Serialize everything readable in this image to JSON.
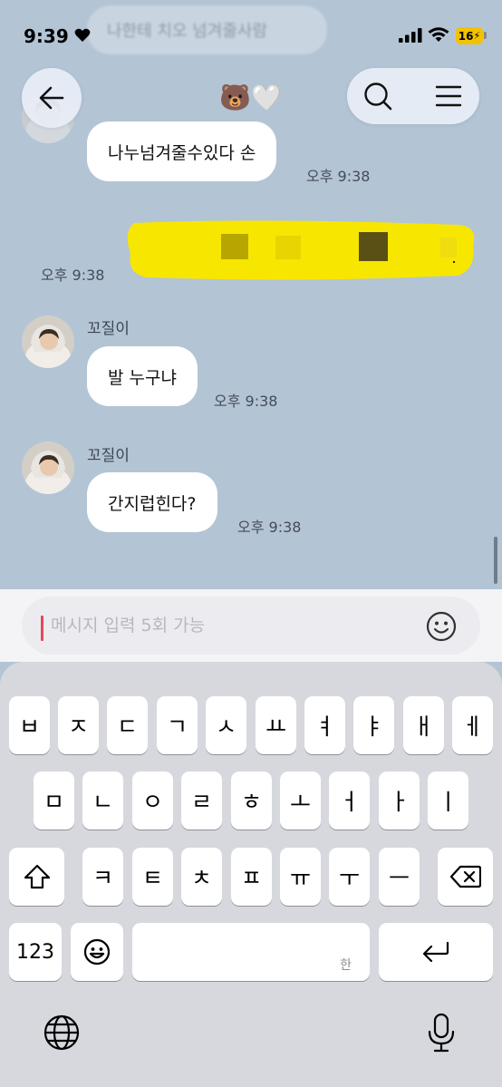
{
  "status_bar": {
    "time": "9:39",
    "battery": "16"
  },
  "header": {
    "back_icon": "arrow-left-icon",
    "title": "🐻🤍",
    "search_icon": "search-icon",
    "menu_icon": "hamburger-menu-icon"
  },
  "faded_message": {
    "text": "나한테 치오 넘겨줄사람"
  },
  "messages": [
    {
      "direction": "in",
      "sender": "",
      "text": "나누넘겨줄수있다 손",
      "time": "오후 9:38"
    },
    {
      "direction": "out",
      "sender": "",
      "text": "",
      "time": "오후 9:38",
      "redacted": true
    },
    {
      "direction": "in",
      "sender": "꼬질이",
      "text": "발 누구냐",
      "time": "오후 9:38"
    },
    {
      "direction": "in",
      "sender": "꼬질이",
      "text": "간지럽힌다?",
      "time": "오후 9:38"
    }
  ],
  "input": {
    "value": "",
    "placeholder": "메시지 입력 5회 가능",
    "emoji_icon": "smiley-icon"
  },
  "keyboard": {
    "row1": [
      "ㅂ",
      "ㅈ",
      "ㄷ",
      "ㄱ",
      "ㅅ",
      "ㅛ",
      "ㅕ",
      "ㅑ",
      "ㅐ",
      "ㅔ"
    ],
    "row2": [
      "ㅁ",
      "ㄴ",
      "ㅇ",
      "ㄹ",
      "ㅎ",
      "ㅗ",
      "ㅓ",
      "ㅏ",
      "ㅣ"
    ],
    "row3": [
      "ㅋ",
      "ㅌ",
      "ㅊ",
      "ㅍ",
      "ㅠ",
      "ㅜ",
      "ㅡ"
    ],
    "numbers_label": "123",
    "space_hint": "한",
    "shift_icon": "shift-icon",
    "delete_icon": "delete-icon",
    "return_icon": "return-icon",
    "emoji_icon": "emoji-icon",
    "globe_icon": "globe-icon",
    "mic_icon": "microphone-icon"
  },
  "colors": {
    "chat_background": "#b3c4d5",
    "highlight": "#f7e600",
    "caret": "#e5475c"
  }
}
